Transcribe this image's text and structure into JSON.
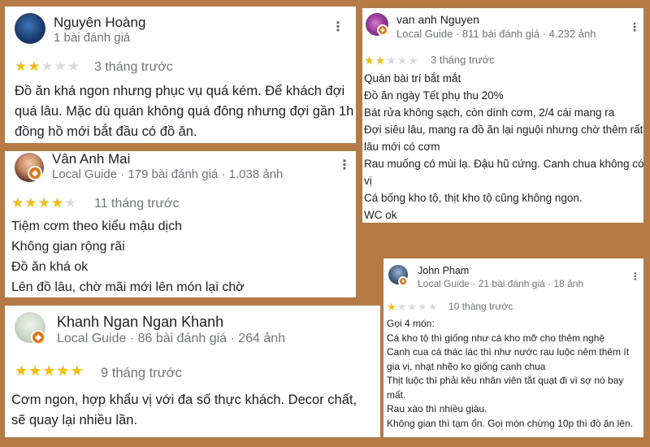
{
  "colors": {
    "background": "#b67a45",
    "star_on": "#fbbc04",
    "star_off": "#dadce0",
    "badge": "#e8710a"
  },
  "reviews": [
    {
      "name": "Nguyên Hoàng",
      "meta": "1 bài đánh giá",
      "rating": 2,
      "time": "3 tháng trước",
      "lines": [
        "Đồ ăn khá ngon nhưng phục vụ quá kém. Để khách đợi",
        "quá lâu. Mặc dù quán không quá đông nhưng đợi gần 1h",
        "đồng hồ mới bắt đầu có đồ ăn."
      ]
    },
    {
      "name": "Vân Anh Mai",
      "meta": "Local Guide · 179 bài đánh giá · 1.038 ảnh",
      "rating": 4,
      "time": "11 tháng trước",
      "lines": [
        "Tiệm cơm theo kiểu mậu dịch",
        "Không gian rộng rãi",
        "Đồ ăn khá ok",
        "Lên đồ lâu, chờ mãi mới lên món lại chờ"
      ]
    },
    {
      "name": "Khanh Ngan Ngan Khanh",
      "meta": "Local Guide · 86 bài đánh giá · 264 ảnh",
      "rating": 5,
      "time": "9 tháng trước",
      "lines": [
        "Cơm ngon, hợp khẩu vị với đa số thực khách. Decor chất,",
        "sẽ quay lại nhiều lần."
      ]
    },
    {
      "name": "van anh Nguyen",
      "meta": "Local Guide · 811 bài đánh giá · 4.232 ảnh",
      "rating": 2,
      "time": "3 tháng trước",
      "lines": [
        "Quán bài trí bắt mắt",
        "Đồ ăn ngày Tết phụ thu 20%",
        "Bát rửa không sạch, còn dính cơm, 2/4 cái mang ra",
        "Đợi siêu lâu, mang ra đồ ăn lại nguội nhưng chờ thêm rất",
        "lâu mới có cơm",
        "Rau muống có mùi lạ. Đậu hũ cứng. Canh chua không có",
        "vị",
        "Cá bống kho tộ, thịt kho tộ cũng không ngon.",
        "WC ok"
      ]
    },
    {
      "name": "John Pham",
      "meta": "Local Guide · 21 bài đánh giá · 18 ảnh",
      "rating": 1,
      "time": "10 tháng trước",
      "lines": [
        "Gọi 4 món:",
        "Cá kho tộ thì giống như cá kho mỡ cho thêm nghệ",
        "Canh cua cá thác lác thì như nước rau luộc nêm thêm ít",
        "gia vị, nhạt nhẽo ko giống canh chua",
        "Thịt luộc thì phải kêu nhân viên tắt quạt đi vì sợ nó bay",
        "mất.",
        "Rau xào thì nhiều giàu.",
        "Không gian thì tạm ổn. Gọi món chừng 10p thì đồ ăn lên."
      ]
    }
  ]
}
